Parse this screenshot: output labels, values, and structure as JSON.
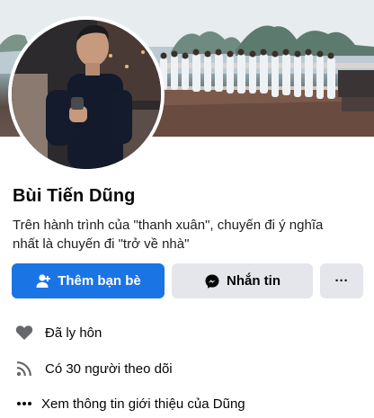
{
  "profile": {
    "name": "Bùi Tiến Dũng",
    "bio_line1": "Trên hành trình của \"thanh xuân\", chuyến đi ý nghĩa",
    "bio_line2": "nhất là chuyến đi \"trở về nhà\""
  },
  "actions": {
    "add_friend_label": "Thêm bạn bè",
    "message_label": "Nhắn tin",
    "more_label": "···"
  },
  "intro": {
    "relationship": "Đã ly hôn",
    "followers": "Có 30 người theo dõi",
    "see_about": "Xem thông tin giới thiệu của Dũng"
  },
  "colors": {
    "primary": "#1b74e4",
    "secondary_bg": "#e4e6eb",
    "icon_gray": "#65676b"
  },
  "icons": {
    "add_friend": "person-plus-icon",
    "message": "messenger-icon",
    "more": "more-dots-icon",
    "relationship": "heart-icon",
    "followers": "rss-feed-icon",
    "see_about": "ellipsis-icon"
  }
}
